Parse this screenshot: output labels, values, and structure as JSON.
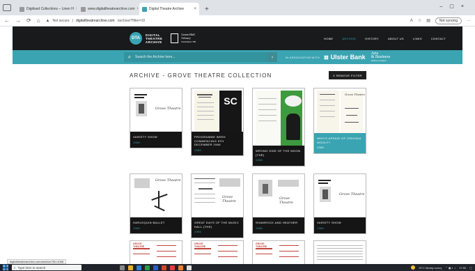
{
  "browser": {
    "tabs": [
      {
        "label": "Digitised Collections – Linen H",
        "active": false
      },
      {
        "label": "www.digitaltheatrearchive.com",
        "active": false
      },
      {
        "label": "Digital Theatre Archive",
        "active": true
      }
    ],
    "new_tab": "+",
    "url_warning": "Not secure",
    "url_host": "digitaltheatrearchive.com",
    "url_path": "/archive/?filter=10",
    "sync_label": "Not syncing"
  },
  "site": {
    "logo_initials": "DTA",
    "logo_line1": "DIGITAL",
    "logo_line2": "THEATRE",
    "logo_line3": "ARCHIVE",
    "partner_line1": "Linen Hall",
    "partner_line2": "Library",
    "partner_line3": "Established 1788",
    "nav": [
      {
        "label": "HOME",
        "current": false
      },
      {
        "label": "ARCHIVE",
        "current": true
      },
      {
        "label": "HISTORY",
        "current": false
      },
      {
        "label": "ABOUT US",
        "current": false
      },
      {
        "label": "LINKS",
        "current": false
      },
      {
        "label": "CONTACT",
        "current": false
      }
    ]
  },
  "search": {
    "placeholder": "Search the Archive here...",
    "association": "IN ASSOCIATION WITH",
    "sponsor1": "Ulster Bank",
    "sponsor2_line1": "Arts",
    "sponsor2_line2": "& Business",
    "sponsor2_line3": "Northern Ireland"
  },
  "page": {
    "heading": "ARCHIVE - GROVE THEATRE COLLECTION",
    "remove_filter": "X REMOVE FILTER"
  },
  "cards": [
    {
      "title": "VARIETY SHOW",
      "year": "1966",
      "hand": "Grove Theatre"
    },
    {
      "title": "PROGRAMME WEEK COMMENCING 5TH DECEMBER 1966",
      "year": "1966",
      "hand": "",
      "poster": "SC"
    },
    {
      "title": "WRONG SIDE OF THE MOON (THE)",
      "year": "1966",
      "hand": ""
    },
    {
      "title": "WHO'S AFRAID OF VIRGINIA WOOLF?",
      "year": "1966",
      "hand": "Grove Theatre"
    },
    {
      "title": "HARLEQUIN BALLET",
      "year": "1966",
      "hand": "Grove Theatre"
    },
    {
      "title": "GREAT DAYS OF THE MUSIC HALL (THE)",
      "year": "1966",
      "hand": "Grove Theatre"
    },
    {
      "title": "SHAMROCK AND HEATHER",
      "year": "1966",
      "hand": "Grove Theatre"
    },
    {
      "title": "VARIETY SHOW",
      "year": "1966",
      "hand": "Grove Theatre"
    }
  ],
  "bottom_thumbs": [
    "GROVE THEATRE",
    "GROVE THEATRE",
    "GROVE THEATRE"
  ],
  "statusbar": "digitaltheatrearchive.com/archive/?ID=1068",
  "taskbar": {
    "search_placeholder": "Type here to search",
    "weather": "15°C  Mostly sunny",
    "time": "17:50"
  }
}
